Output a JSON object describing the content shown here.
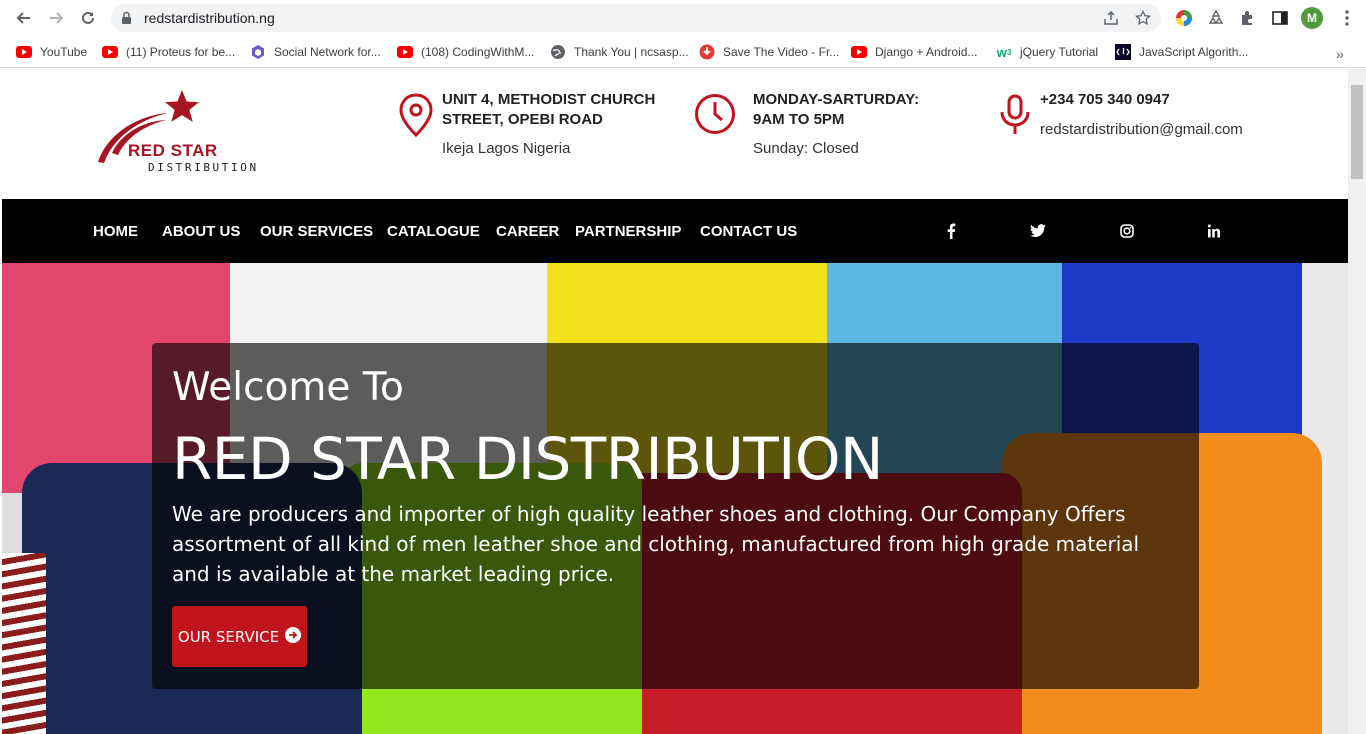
{
  "browser": {
    "url": "redstardistribution.ng",
    "profile_initial": "M",
    "bookmarks": [
      {
        "label": "YouTube",
        "icon": "youtube-icon"
      },
      {
        "label": "(11) Proteus for be...",
        "icon": "youtube-icon"
      },
      {
        "label": "Social Network for...",
        "icon": "hex-icon"
      },
      {
        "label": "(108) CodingWithM...",
        "icon": "youtube-icon"
      },
      {
        "label": "Thank You | ncsasp...",
        "icon": "globe-icon"
      },
      {
        "label": "Save The Video - Fr...",
        "icon": "download-icon"
      },
      {
        "label": "Django + Android...",
        "icon": "youtube-icon"
      },
      {
        "label": "jQuery Tutorial",
        "icon": "w3schools-icon"
      },
      {
        "label": "JavaScript Algorith...",
        "icon": "fcc-icon"
      }
    ],
    "more_bookmarks": "»"
  },
  "site": {
    "logo": {
      "line1": "RED STAR",
      "line2": "DISTRIBUTION"
    },
    "address": {
      "line1": "UNIT 4, METHODIST CHURCH",
      "line2": "STREET, OPEBI ROAD",
      "line3": "Ikeja Lagos Nigeria"
    },
    "hours": {
      "line1": "MONDAY-SARTURDAY:",
      "line2": "9AM TO 5PM",
      "line3": "Sunday: Closed"
    },
    "contact": {
      "phone": "+234 705 340 0947",
      "email": "redstardistribution@gmail.com"
    },
    "nav": [
      "HOME",
      "ABOUT US",
      "OUR SERVICES",
      "CATALOGUE",
      "CAREER",
      "PARTNERSHIP",
      "CONTACT US"
    ],
    "social": [
      "facebook-icon",
      "twitter-icon",
      "instagram-icon",
      "linkedin-icon"
    ],
    "hero": {
      "welcome": "Welcome To",
      "brand": "RED STAR DISTRIBUTION",
      "description": "We are producers and importer of high quality leather shoes and clothing. Our Company Offers assortment of all kind of men leather shoe and clothing, manufactured from high grade material and is available at the market leading price.",
      "cta": "OUR SERVICE"
    },
    "colors": {
      "brand_red": "#a31622",
      "cta_red": "#c0141c",
      "nav_bg": "#000000"
    }
  }
}
